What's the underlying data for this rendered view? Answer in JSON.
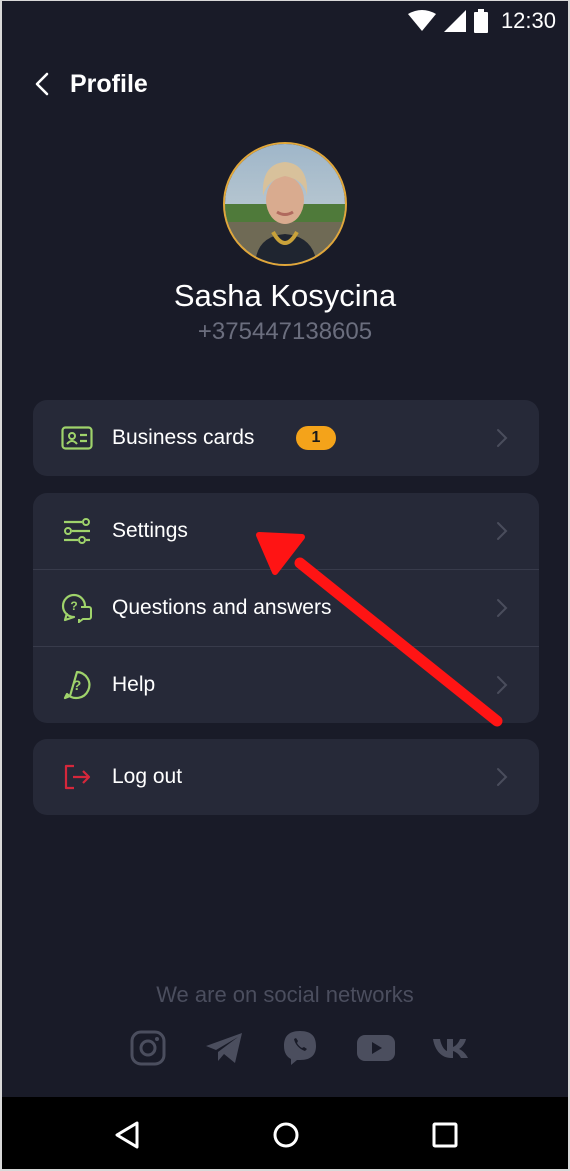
{
  "status_bar": {
    "time": "12:30"
  },
  "header": {
    "title": "Profile"
  },
  "profile": {
    "name": "Sasha Kosycina",
    "phone": "+375447138605"
  },
  "menu": {
    "business_cards": {
      "label": "Business cards",
      "badge": "1"
    },
    "settings": {
      "label": "Settings"
    },
    "questions": {
      "label": "Questions and answers"
    },
    "help": {
      "label": "Help"
    },
    "logout": {
      "label": "Log out"
    }
  },
  "social": {
    "title": "We are on social networks",
    "networks": [
      "instagram-icon",
      "telegram-icon",
      "viber-icon",
      "youtube-icon",
      "vk-icon"
    ]
  },
  "colors": {
    "background": "#191b28",
    "card": "#262938",
    "accent_green": "#9fd36b",
    "badge": "#f4a31a",
    "logout_red": "#d5273b",
    "social_gray": "#4b4e5e",
    "annotation_red": "#ff1414"
  }
}
